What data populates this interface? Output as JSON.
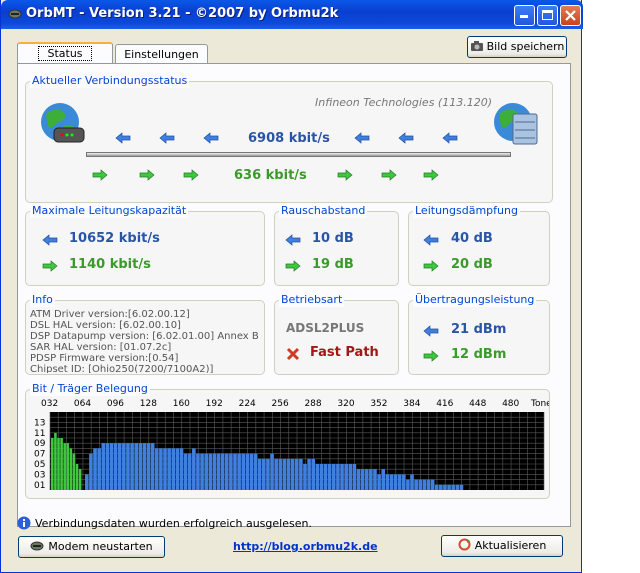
{
  "window": {
    "title": "OrbMT - Version 3.21 - ©2007 by Orbmu2k"
  },
  "tabs": [
    {
      "label": "Status"
    },
    {
      "label": "Einstellungen"
    }
  ],
  "toolbar": {
    "save_image_label": "Bild speichern"
  },
  "connection": {
    "caption": "Aktueller Verbindungsstatus",
    "vendor": "Infineon Technologies (113.120)",
    "downstream": "6908 kbit/s",
    "upstream": "636 kbit/s"
  },
  "capacity": {
    "caption": "Maximale Leitungskapazität",
    "down": "10652 kbit/s",
    "up": "1140 kbit/s"
  },
  "snr": {
    "caption": "Rauschabstand",
    "down": "10 dB",
    "up": "19 dB"
  },
  "attenuation": {
    "caption": "Leitungsdämpfung",
    "down": "40 dB",
    "up": "20 dB"
  },
  "info": {
    "caption": "Info",
    "lines": [
      "ATM Driver version:[6.02.00.12]",
      "DSL HAL version: [6.02.00.10]",
      "DSP Datapump version: [6.02.01.00] Annex B",
      "SAR HAL version: [01.07.2c]",
      "PDSP Firmware version:[0.54]",
      "Chipset ID: [Ohio250(7200/7100A2)]"
    ]
  },
  "mode": {
    "caption": "Betriebsart",
    "standard": "ADSL2PLUS",
    "path": "Fast Path"
  },
  "power": {
    "caption": "Übertragungsleistung",
    "down": "21 dBm",
    "up": "12 dBm"
  },
  "chart_title": "Bit / Träger Belegung",
  "chart_data": {
    "type": "bar",
    "title": "Bit / Träger Belegung",
    "x_ticks": [
      "032",
      "064",
      "096",
      "128",
      "160",
      "192",
      "224",
      "256",
      "288",
      "320",
      "352",
      "384",
      "416",
      "448",
      "480",
      "Tone"
    ],
    "y_ticks": [
      "13",
      "11",
      "09",
      "07",
      "05",
      "03",
      "01"
    ],
    "xlim": [
      32,
      512
    ],
    "ylim": [
      0,
      15
    ],
    "grid": true,
    "series": [
      {
        "color": "#3ec83e",
        "x": [
          33,
          36,
          39,
          42,
          45,
          48,
          51,
          54,
          57,
          60
        ],
        "values": [
          10,
          11,
          10,
          10,
          9,
          9,
          8,
          7,
          5,
          4
        ]
      },
      {
        "color": "#3f7fe0",
        "x": [
          66,
          70,
          74,
          78,
          82,
          86,
          90,
          94,
          98,
          102,
          106,
          110,
          114,
          118,
          122,
          126,
          130,
          134,
          138,
          142,
          146,
          150,
          154,
          158,
          162,
          166,
          170,
          174,
          178,
          182,
          186,
          190,
          194,
          198,
          202,
          206,
          210,
          214,
          218,
          222,
          226,
          230,
          234,
          238,
          242,
          246,
          250,
          254,
          258,
          262,
          266,
          270,
          274,
          278,
          282,
          286,
          290,
          294,
          298,
          302,
          306,
          310,
          314,
          318,
          322,
          326,
          330,
          334,
          338,
          342,
          346,
          350,
          354,
          358,
          362,
          366,
          370,
          374,
          378,
          382,
          386,
          390,
          394,
          398,
          402,
          406,
          410,
          414,
          418,
          422,
          426,
          430
        ],
        "values": [
          3,
          7,
          8,
          8,
          9,
          9,
          9,
          9,
          9,
          9,
          9,
          9,
          9,
          9,
          9,
          9,
          9,
          8,
          8,
          8,
          8,
          8,
          8,
          8,
          7,
          7,
          8,
          7,
          7,
          7,
          7,
          7,
          7,
          7,
          7,
          7,
          7,
          7,
          7,
          7,
          7,
          7,
          6,
          6,
          6,
          7,
          6,
          6,
          6,
          6,
          6,
          6,
          6,
          5,
          6,
          6,
          5,
          5,
          5,
          5,
          5,
          5,
          5,
          5,
          5,
          5,
          4,
          4,
          4,
          4,
          4,
          3,
          4,
          3,
          3,
          3,
          3,
          3,
          2,
          3,
          2,
          2,
          2,
          2,
          2,
          1,
          1,
          1,
          1,
          1,
          1,
          1
        ]
      }
    ]
  },
  "status_message": "Verbindungsdaten wurden erfolgreich ausgelesen.",
  "footer": {
    "restart_label": "Modem neustarten",
    "link": "http://blog.orbmu2k.de",
    "refresh_label": "Aktualisieren"
  },
  "colors": {
    "down": "#3f7fe0",
    "up": "#3ec83e",
    "title": "#0a3fd0"
  }
}
